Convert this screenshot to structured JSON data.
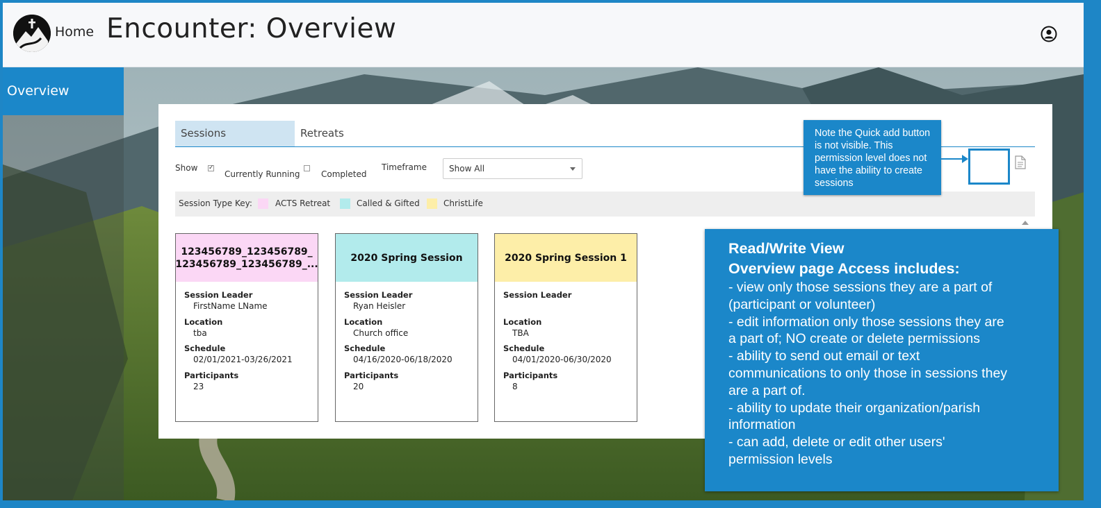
{
  "header": {
    "home_label": "Home",
    "title": "Encounter: Overview"
  },
  "sidebar": {
    "items": [
      {
        "label": "Overview",
        "active": true
      }
    ]
  },
  "tabs": [
    {
      "label": "Sessions",
      "active": true
    },
    {
      "label": "Retreats",
      "active": false
    }
  ],
  "filters": {
    "show_label": "Show",
    "currently_running": {
      "label": "Currently Running",
      "checked": true
    },
    "completed": {
      "label": "Completed",
      "checked": false
    },
    "timeframe_label": "Timeframe",
    "timeframe_value": "Show All"
  },
  "session_key": {
    "label": "Session Type Key:",
    "items": [
      {
        "label": "ACTS Retreat",
        "color": "#fbd7f5"
      },
      {
        "label": "Called & Gifted",
        "color": "#b2ebec"
      },
      {
        "label": "ChristLife",
        "color": "#fdeea8"
      }
    ]
  },
  "field_labels": {
    "leader": "Session Leader",
    "location": "Location",
    "schedule": "Schedule",
    "participants": "Participants"
  },
  "sessions": [
    {
      "title": "123456789_123456789_ 123456789_123456789_...",
      "color": "#fbd7f5",
      "leader": "FirstName LName",
      "location": "tba",
      "schedule": "02/01/2021-03/26/2021",
      "participants": "23"
    },
    {
      "title": "2020 Spring Session",
      "color": "#b2ebec",
      "leader": "Ryan Heisler",
      "location": "Church office",
      "schedule": "04/16/2020-06/18/2020",
      "participants": "20"
    },
    {
      "title": "2020 Spring Session 1",
      "color": "#fdeea8",
      "leader": "",
      "location": "TBA",
      "schedule": "04/01/2020-06/30/2020",
      "participants": "8"
    }
  ],
  "note_callout": {
    "text": "Note the Quick add button is not visible. This permission level does not have the ability to create sessions"
  },
  "rw_callout": {
    "heading1": "Read/Write View",
    "heading2": "Overview page Access includes:",
    "lines": [
      "- view only those sessions they are a part of",
      "(participant or volunteer)",
      "- edit information only those sessions they are",
      "a part of; NO create or delete permissions",
      "- ability to send out email or text",
      "communications to only those in sessions they",
      "are a part of.",
      "- ability to update their organization/parish",
      "information",
      "- can add, delete or edit other users'",
      "permission levels"
    ]
  },
  "colors": {
    "accent": "#1b87c9",
    "header_bg": "#f7f8fa"
  }
}
